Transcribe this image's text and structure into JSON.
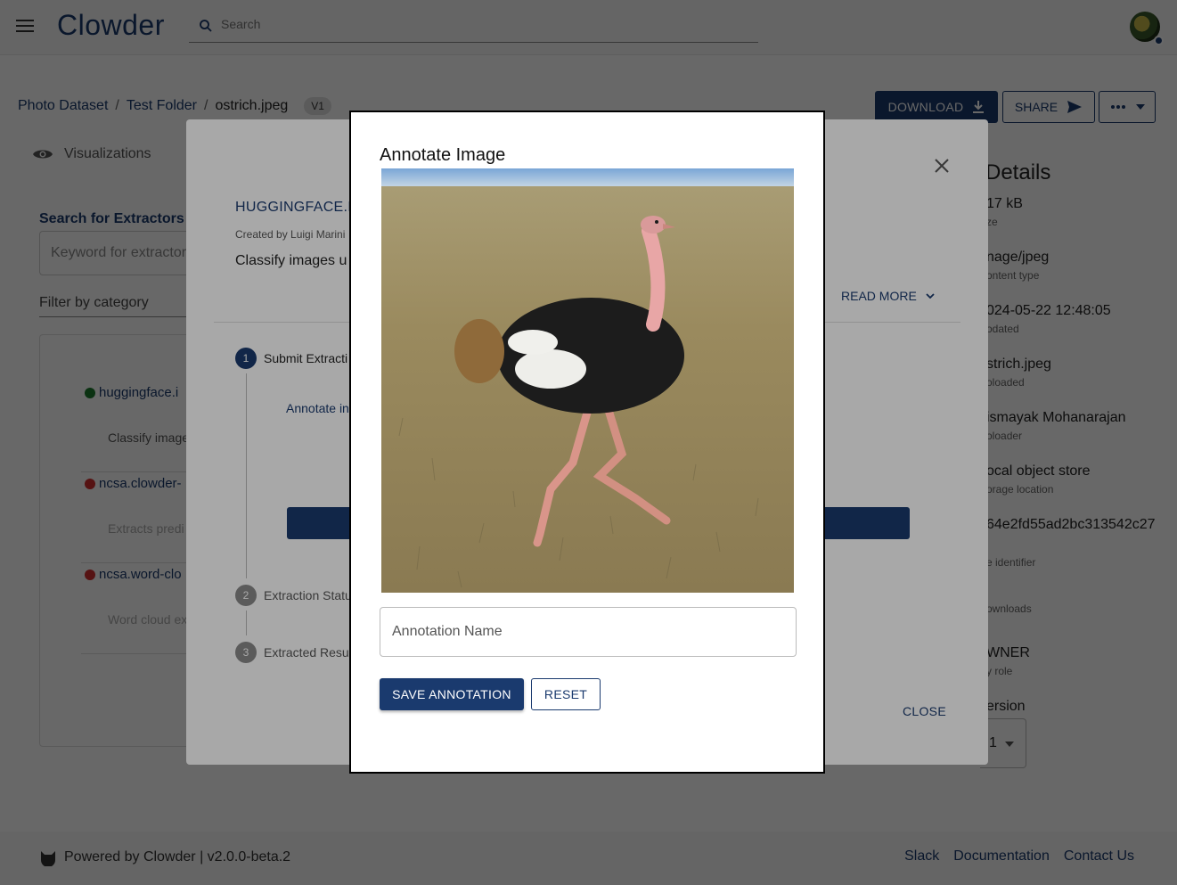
{
  "app": {
    "name": "Clowder"
  },
  "search": {
    "placeholder": "Search"
  },
  "breadcrumb": {
    "items": [
      "Photo Dataset",
      "Test Folder",
      "ostrich.jpeg"
    ],
    "version": "V1"
  },
  "actions": {
    "download": "DOWNLOAD",
    "share": "SHARE"
  },
  "tabs": {
    "visualizations": "Visualizations"
  },
  "left_panel": {
    "title": "Search for Extractors",
    "keyword_placeholder": "Keyword for extractor",
    "filter_label": "Filter by category",
    "extractors": [
      {
        "name": "huggingface.i",
        "desc": "Classify image",
        "status_color": "#1e7b2e"
      },
      {
        "name": "ncsa.clowder-",
        "desc": "Extracts predi",
        "status_color": "#d32f2f"
      },
      {
        "name": "ncsa.word-clo",
        "desc": "Word cloud ex",
        "status_color": "#d32f2f"
      }
    ]
  },
  "details": {
    "title": "Details",
    "rows": [
      {
        "value": "17 kB",
        "label": "ze"
      },
      {
        "value": "nage/jpeg",
        "label": "ontent type"
      },
      {
        "value": "024-05-22 12:48:05",
        "label": "odated"
      },
      {
        "value": "strich.jpeg",
        "label": "oloaded"
      },
      {
        "value": "ismayak Mohanarajan",
        "label": "oloader"
      },
      {
        "value": "ocal object store",
        "label": "orage location"
      },
      {
        "value": "64e2fd55ad2bc313542c27",
        "label": "e identifier"
      },
      {
        "value": "",
        "label": "ownloads"
      },
      {
        "value": "WNER",
        "label": "y role"
      },
      {
        "value": "ersion",
        "label": ""
      }
    ],
    "version_value": "1"
  },
  "extractor_dialog": {
    "name": "HUGGINGFACE.I",
    "author": "Created by Luigi Marini",
    "description": "Classify images u",
    "read_more": "READ MORE",
    "steps": [
      {
        "num": "1",
        "label": "Submit Extracti"
      },
      {
        "num": "2",
        "label": "Extraction Statu"
      },
      {
        "num": "3",
        "label": "Extracted Resu"
      }
    ],
    "annotate_link": "Annotate in",
    "close": "CLOSE"
  },
  "annotate_dialog": {
    "title": "Annotate Image",
    "name_placeholder": "Annotation Name",
    "save": "SAVE ANNOTATION",
    "reset": "RESET"
  },
  "footer": {
    "powered_by": "Powered by Clowder | v2.0.0-beta.2",
    "links": [
      "Slack",
      "Documentation",
      "Contact Us"
    ]
  },
  "colors": {
    "brand": "#1a3a6e",
    "active_step": "#1a3a6e",
    "inactive_step": "#8a8a8a"
  }
}
